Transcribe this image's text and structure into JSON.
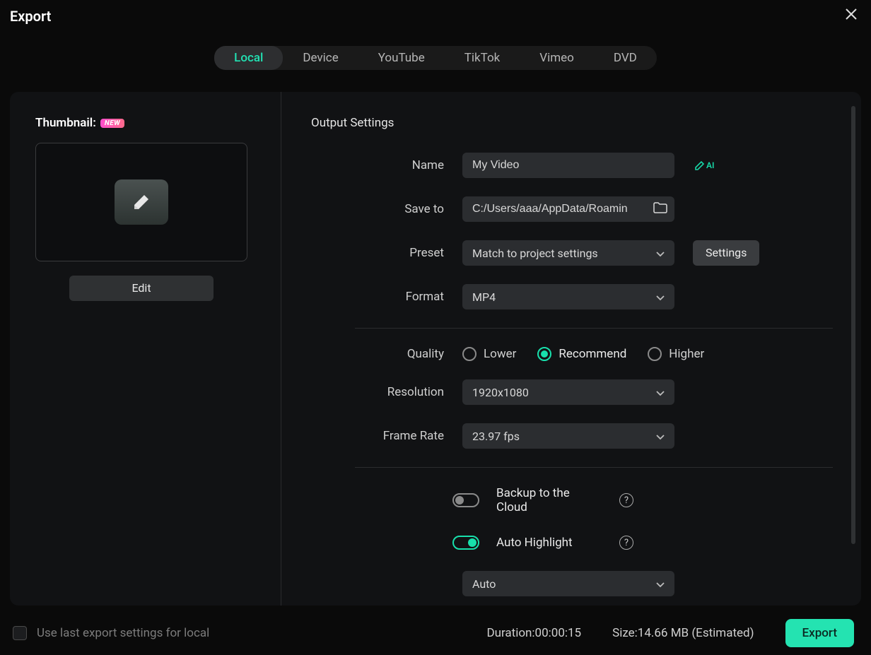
{
  "title": "Export",
  "tabs": [
    "Local",
    "Device",
    "YouTube",
    "TikTok",
    "Vimeo",
    "DVD"
  ],
  "activeTab": 0,
  "thumbnail": {
    "label": "Thumbnail:",
    "badge": "NEW",
    "editLabel": "Edit"
  },
  "output": {
    "sectionTitle": "Output Settings",
    "nameLabel": "Name",
    "nameValue": "My Video",
    "aiLabel": "AI",
    "saveToLabel": "Save to",
    "saveToValue": "C:/Users/aaa/AppData/Roamin",
    "presetLabel": "Preset",
    "presetValue": "Match to project settings",
    "settingsBtn": "Settings",
    "formatLabel": "Format",
    "formatValue": "MP4",
    "qualityLabel": "Quality",
    "qualityOptions": {
      "lower": "Lower",
      "recommend": "Recommend",
      "higher": "Higher"
    },
    "resolutionLabel": "Resolution",
    "resolutionValue": "1920x1080",
    "frameRateLabel": "Frame Rate",
    "frameRateValue": "23.97 fps",
    "backupLabel": "Backup to the Cloud",
    "autoHighlightLabel": "Auto Highlight",
    "autoHighlightMode": "Auto"
  },
  "footer": {
    "lastSettings": "Use last export settings for local",
    "durationLabel": "Duration:",
    "durationValue": "00:00:15",
    "sizeLabel": "Size:",
    "sizeValue": "14.66 MB",
    "sizeSuffix": "(Estimated)",
    "exportBtn": "Export"
  }
}
